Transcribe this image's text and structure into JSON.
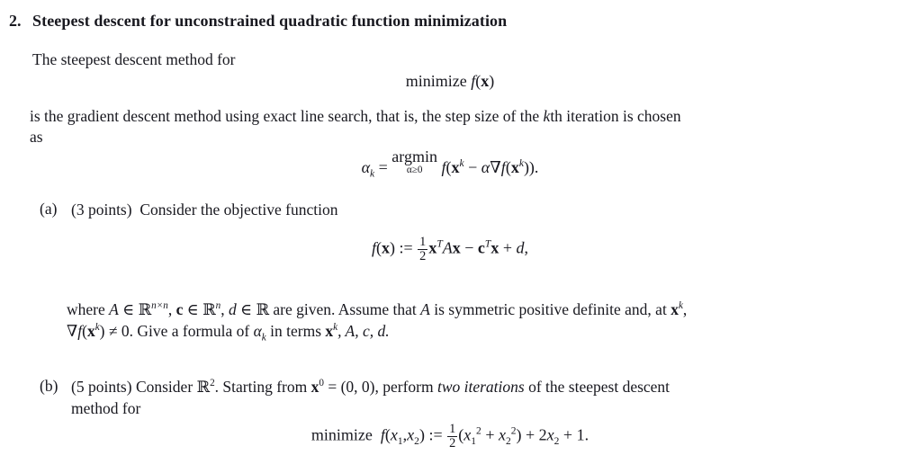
{
  "document": {
    "problem_number": "2.",
    "title": "Steepest descent for unconstrained quadratic function minimization",
    "intro_text": "The steepest descent method for",
    "gradient_text_line1": "is the gradient descent method using exact line search, that is, the step size of the ",
    "gradient_k": "k",
    "gradient_text_line1_end": "th iteration is chosen",
    "gradient_text_line2": "as"
  },
  "equations": {
    "minimize_fx": {
      "operator": "minimize",
      "function": "f",
      "argument": "x"
    },
    "argmin_alpha": {
      "lhs_alpha": "α",
      "lhs_sub": "k",
      "equals": "=",
      "operator": "argmin",
      "limit": "α≥0",
      "body_f": "f",
      "body_open": "(",
      "body_x": "x",
      "body_x_sup": "k",
      "body_minus": "−",
      "body_alpha": "α",
      "body_nabla": "∇",
      "body_f2": "f",
      "body_x2": "x",
      "body_x2_sup": "k",
      "body_close": "))."
    },
    "f_definition": {
      "f": "f",
      "x": "x",
      "assign": ":=",
      "frac_num": "1",
      "frac_den": "2",
      "xT": "x",
      "T1": "T",
      "A": "A",
      "Ax": "x",
      "minus": "−",
      "c": "c",
      "T2": "T",
      "x3": "x",
      "plus": "+",
      "d": "d",
      "comma": ","
    },
    "minimize_quadratic": {
      "operator": "minimize",
      "f": "f",
      "open": "(",
      "x1": "x",
      "x1_sub": "1",
      "comma": ",",
      "x2": "x",
      "x2_sub": "2",
      "close": ")",
      "assign": ":=",
      "frac_num": "1",
      "frac_den": "2",
      "group_open": "(",
      "t1_x": "x",
      "t1_sub": "1",
      "t1_sup": "2",
      "plus1": "+",
      "t2_x": "x",
      "t2_sub": "2",
      "t2_sup": "2",
      "group_close": ")",
      "plus2": "+",
      "coef": "2",
      "t3_x": "x",
      "t3_sub": "2",
      "plus3": "+",
      "constant": "1",
      "period": "."
    }
  },
  "parts": {
    "a": {
      "label": "(a)",
      "points": "(3 points)",
      "prompt": "Consider the objective function",
      "where_prefix": "where ",
      "where_A": "A",
      "where_in1": " ∈ ",
      "where_Rnn": "ℝ",
      "where_Rnn_sup": "n×n",
      "where_comma1": ", ",
      "where_c": "c",
      "where_in2": " ∈ ",
      "where_Rn": "ℝ",
      "where_Rn_sup": "n",
      "where_comma2": ", ",
      "where_d": "d",
      "where_in3": " ∈ ",
      "where_R": "ℝ",
      "where_given": " are given. Assume that ",
      "where_A2": "A",
      "where_spd": " is symmetric positive definite and, at ",
      "where_xk": "x",
      "where_xk_sup": "k",
      "where_end": ",",
      "line2_nabla": "∇",
      "line2_f": "f",
      "line2_x": "x",
      "line2_x_sup": "k",
      "line2_neq": ") ≠ 0. Give a formula of ",
      "line2_alpha": "α",
      "line2_alpha_sub": "k",
      "line2_terms": " in terms ",
      "line2_xk": "x",
      "line2_xk_sup": "k",
      "line2_tail": ", A, c, d."
    },
    "b": {
      "label": "(b)",
      "points": "(5 points)",
      "prompt_1": "Consider ",
      "prompt_R2": "ℝ",
      "prompt_R2_sup": "2",
      "prompt_2": ". Starting from ",
      "prompt_x0": "x",
      "prompt_x0_sup": "0",
      "prompt_3": " = (0, 0), perform ",
      "prompt_emph": "two iterations",
      "prompt_4": " of the steepest descent",
      "prompt_line2": "method for"
    }
  },
  "colors": {
    "background": "#ffffff",
    "text": "#18181f"
  }
}
